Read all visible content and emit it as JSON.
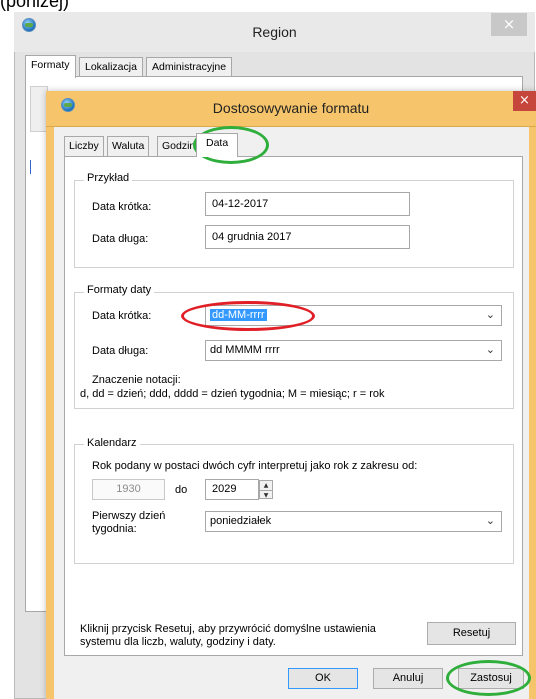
{
  "page_caption": "(poniżej)",
  "region": {
    "title": "Region",
    "close_glyph": "×",
    "tabs": [
      "Formaty",
      "Lokalizacja",
      "Administracyjne"
    ]
  },
  "dialog": {
    "title": "Dostosowywanie formatu",
    "close_glyph": "×",
    "tabs": [
      "Liczby",
      "Waluta",
      "Godzina",
      "Data"
    ],
    "example": {
      "legend": "Przykład",
      "short_label": "Data krótka:",
      "short_value": "04-12-2017",
      "long_label": "Data długa:",
      "long_value": "04 grudnia 2017"
    },
    "formats": {
      "legend": "Formaty daty",
      "short_label": "Data krótka:",
      "short_value": "dd-MM-rrrr",
      "long_label": "Data długa:",
      "long_value": "dd MMMM rrrr",
      "notation_title": "Znaczenie notacji:",
      "notation_text": "d, dd = dzień;  ddd, dddd = dzień tygodnia;  M = miesiąc;  r = rok"
    },
    "calendar": {
      "legend": "Kalendarz",
      "two_digit_text": "Rok podany w postaci dwóch cyfr interpretuj jako rok z zakresu od:",
      "from_year": "1930",
      "to_label": "do",
      "to_year": "2029",
      "first_day_label_1": "Pierwszy dzień",
      "first_day_label_2": "tygodnia:",
      "first_day_value": "poniedziałek"
    },
    "reset_text_1": "Kliknij przycisk Resetuj, aby przywrócić domyślne ustawienia",
    "reset_text_2": "systemu dla liczb, waluty, godziny i daty.",
    "buttons": {
      "reset": "Resetuj",
      "ok": "OK",
      "cancel": "Anuluj",
      "apply": "Zastosuj"
    }
  },
  "icons": {
    "chevron": "⌄",
    "spin_up": "▲",
    "spin_down": "▼"
  },
  "colors": {
    "dialog_title_bar": "#f6c56b",
    "dialog_close": "#c7463c",
    "selection": "#3399ff",
    "annotation_green": "#2fae3b",
    "annotation_red": "#e11f26"
  }
}
